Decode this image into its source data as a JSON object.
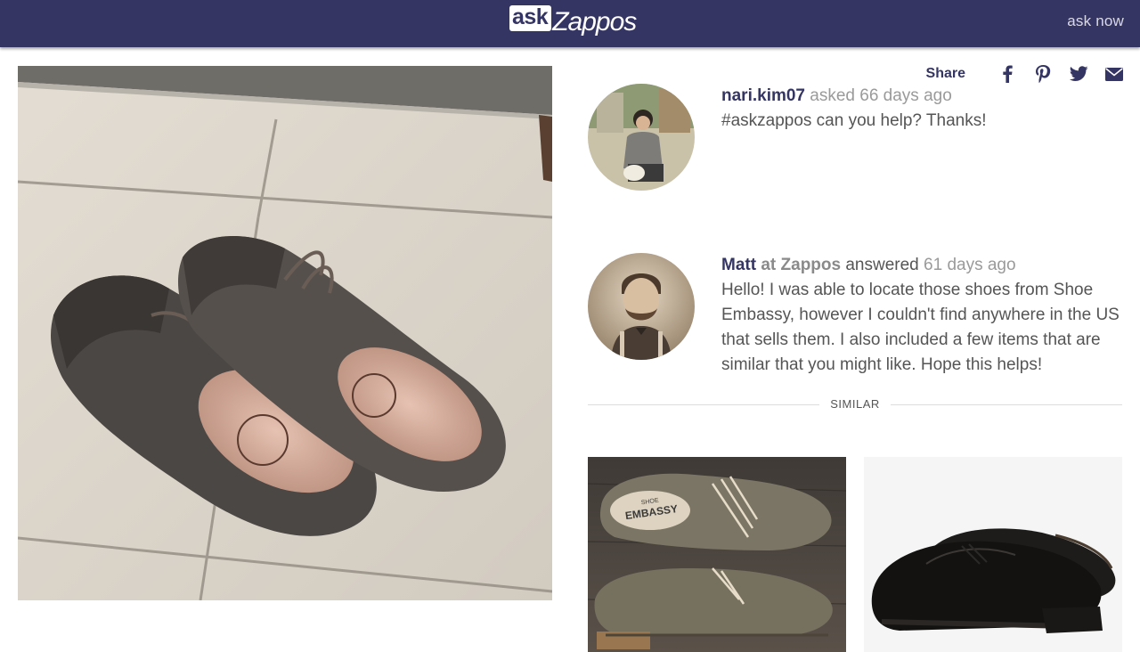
{
  "header": {
    "logo_ask": "ask",
    "logo_zappos": "Zappos",
    "ask_now": "ask now"
  },
  "share": {
    "label": "Share",
    "icons": [
      "facebook-icon",
      "pinterest-icon",
      "twitter-icon",
      "email-icon"
    ]
  },
  "question": {
    "user": "nari.kim07",
    "action": "asked",
    "time": "66 days ago",
    "text": "#askzappos can you help? Thanks!"
  },
  "answer": {
    "user": "Matt",
    "at": "at Zappos",
    "action": "answered",
    "time": "61 days ago",
    "text": "Hello! I was able to locate those shoes from Shoe Embassy, however I couldn't find anywhere in the US that sells them. I also included a few items that are similar that you might like. Hope this helps!"
  },
  "similar": {
    "label": "SIMILAR"
  },
  "products": [
    {
      "stamp_top": "SHOE",
      "stamp_brand": "EMBASSY"
    },
    {}
  ],
  "colors": {
    "header_bg": "#353564",
    "brand_text": "#353564",
    "body_text": "#555555",
    "muted_text": "#9a9a9a"
  }
}
